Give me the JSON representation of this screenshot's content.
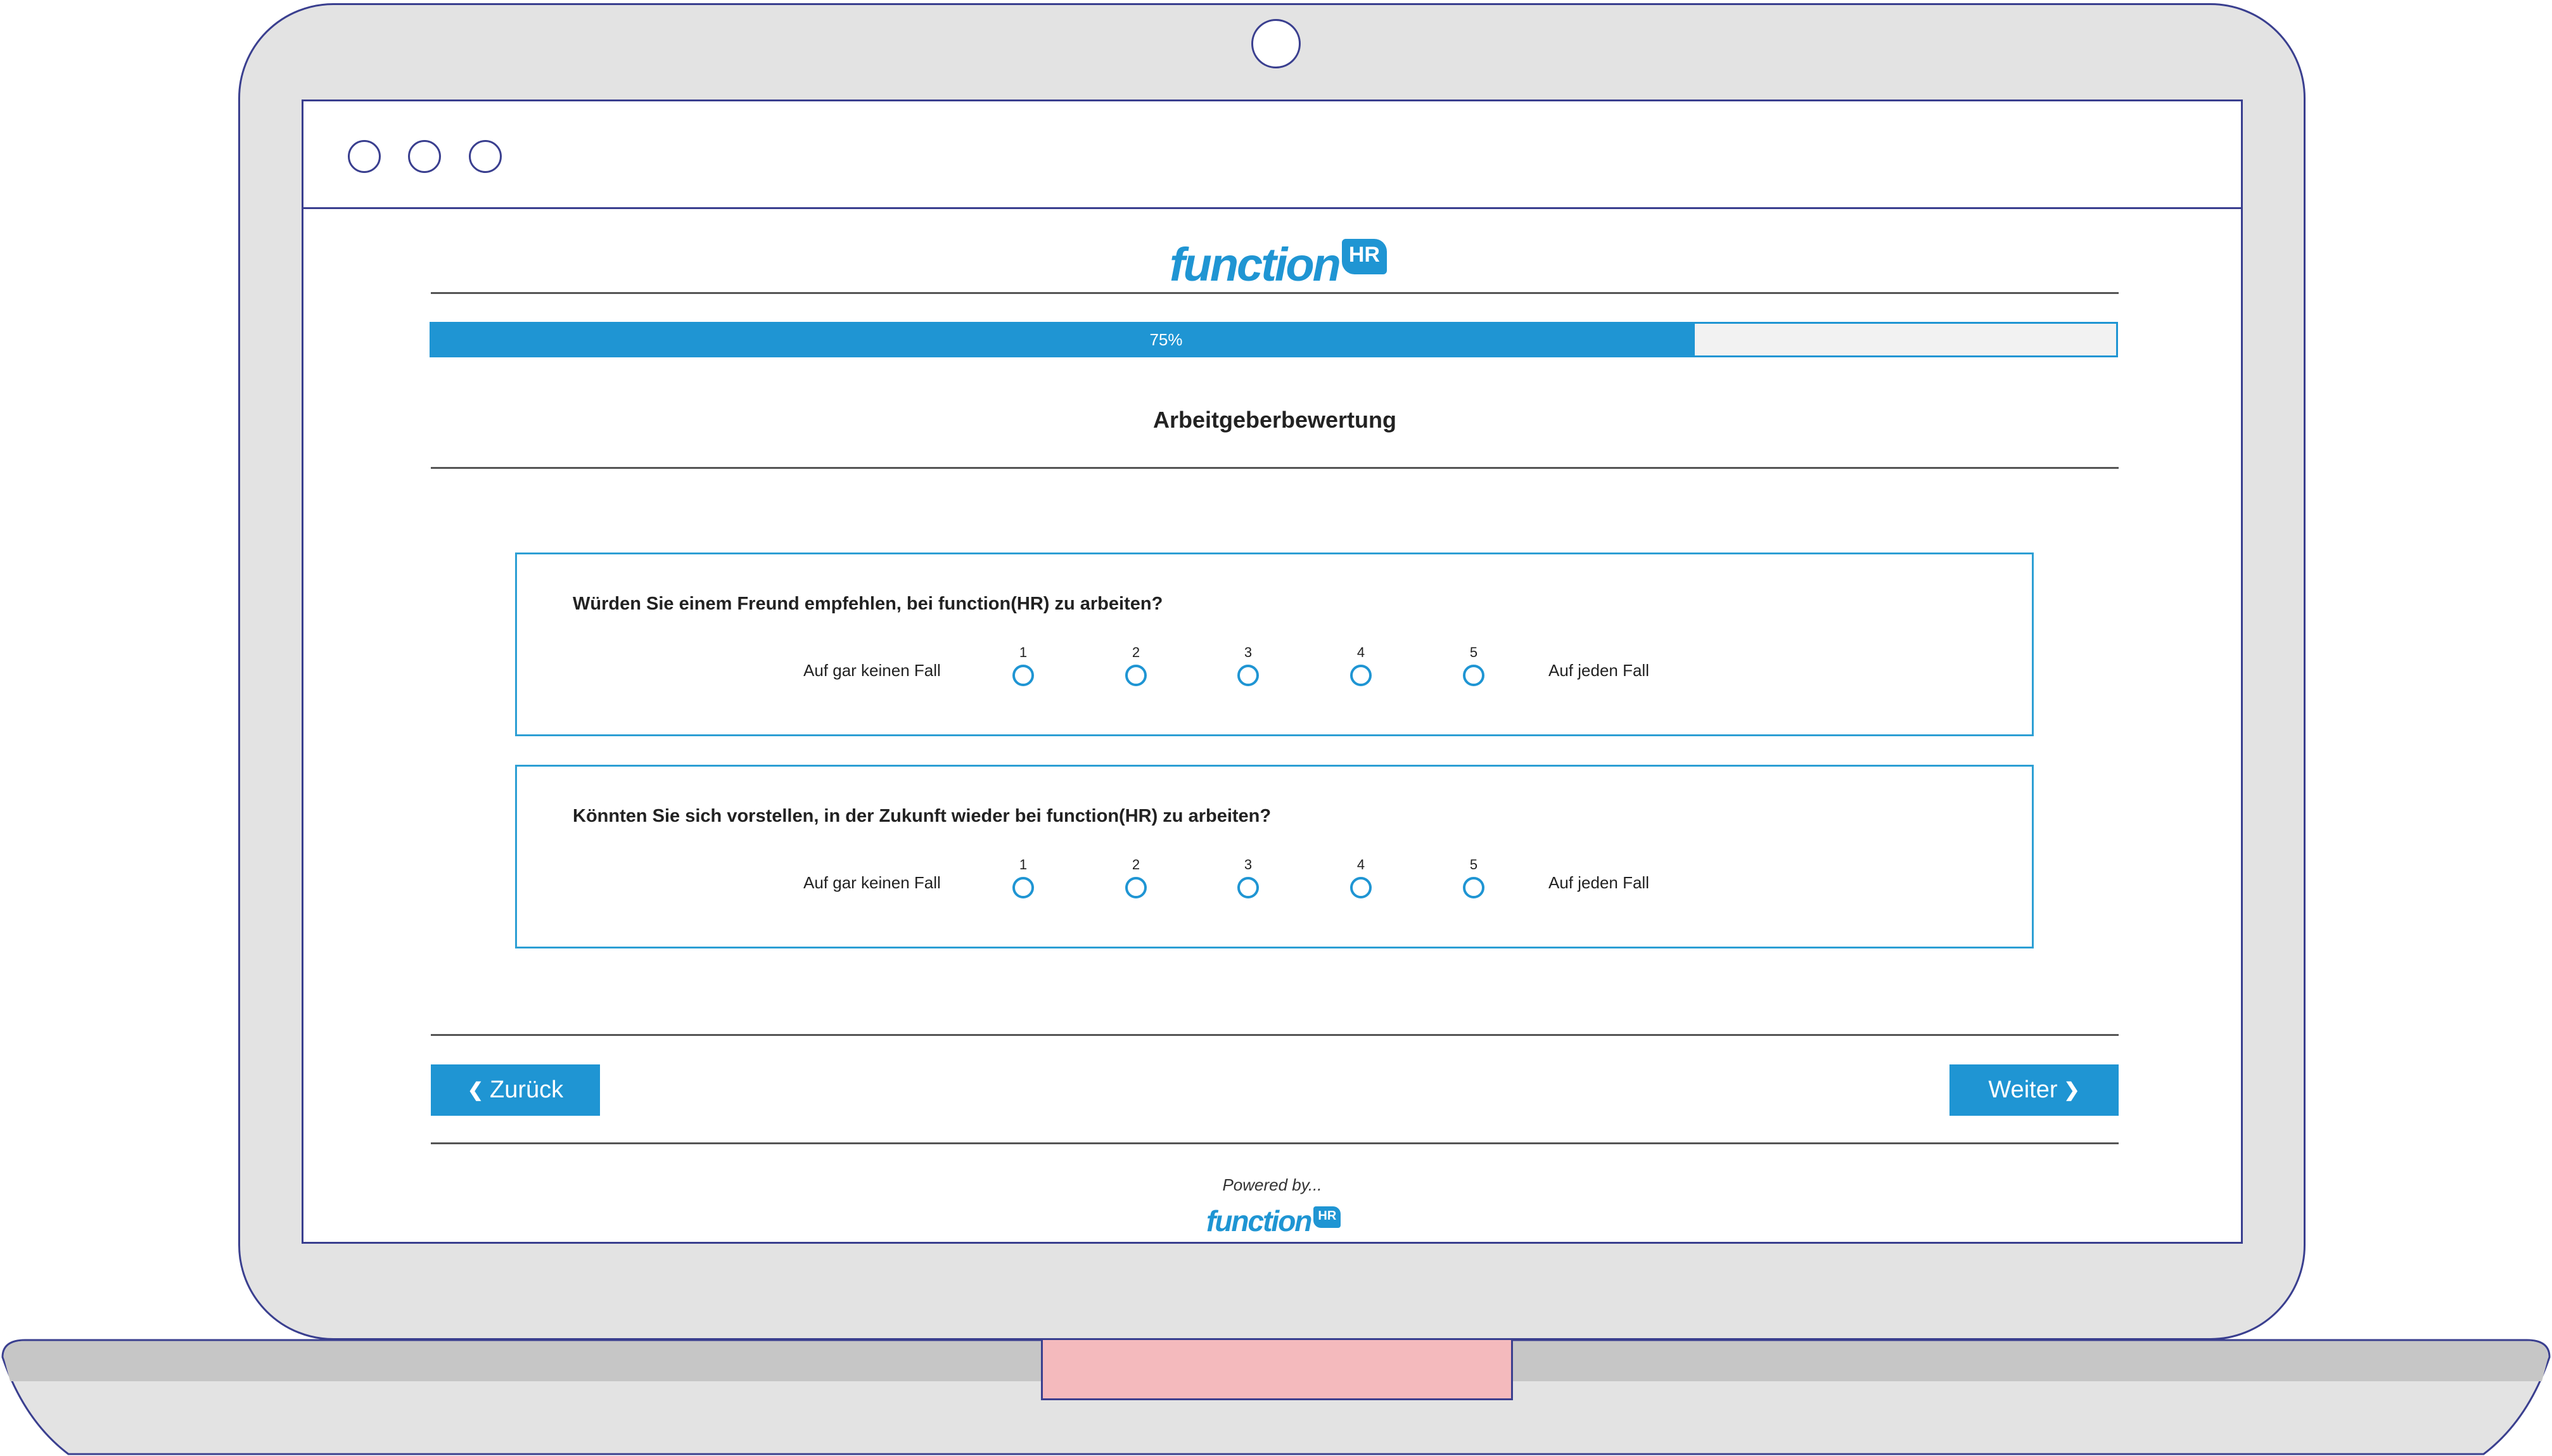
{
  "brand": {
    "logo_text": "function",
    "logo_badge": "HR",
    "color": "#1f95d3"
  },
  "progress": {
    "label": "75%",
    "fraction": 0.75
  },
  "section_title": "Arbeitgeberbewertung",
  "questions": [
    {
      "text": "Würden Sie einem Freund empfehlen, bei function(HR) zu arbeiten?",
      "low_label": "Auf gar keinen Fall",
      "high_label": "Auf jeden Fall",
      "options": [
        "1",
        "2",
        "3",
        "4",
        "5"
      ]
    },
    {
      "text": "Könnten Sie sich vorstellen, in der Zukunft wieder bei function(HR) zu arbeiten?",
      "low_label": "Auf gar keinen Fall",
      "high_label": "Auf jeden Fall",
      "options": [
        "1",
        "2",
        "3",
        "4",
        "5"
      ]
    }
  ],
  "nav": {
    "back_label": "Zurück",
    "next_label": "Weiter"
  },
  "footer": {
    "powered_by": "Powered by..."
  },
  "icons": {
    "back": "chevron-left-icon",
    "next": "chevron-right-icon",
    "radio": "radio-unchecked-icon"
  }
}
